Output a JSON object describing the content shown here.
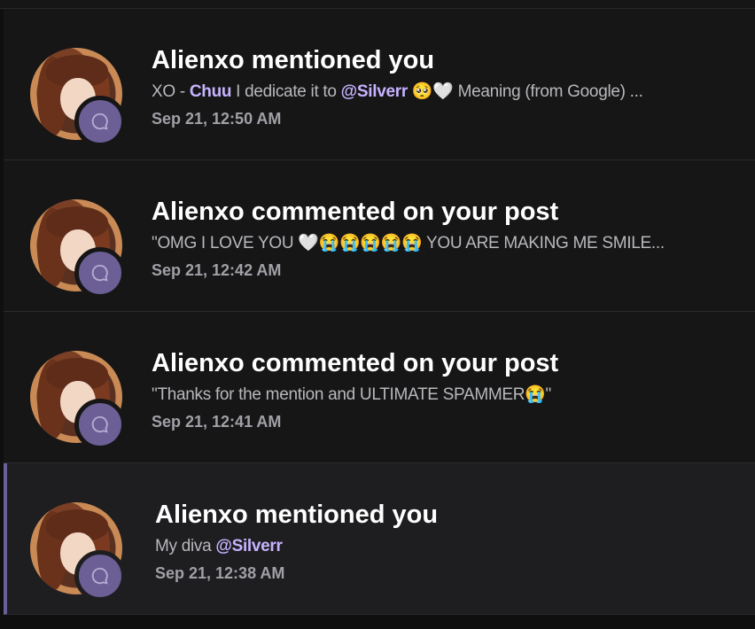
{
  "notifications": [
    {
      "title": "Alienxo mentioned you",
      "body_prefix": "XO - ",
      "body_mention1": "Chuu",
      "body_mid": " I dedicate it to ",
      "body_mention2": "@Silverr",
      "body_suffix": " 🥺🤍 Meaning (from Google) ...",
      "time": "Sep 21, 12:50 AM",
      "unread": false
    },
    {
      "title": "Alienxo commented on your post",
      "body": "\"OMG I LOVE YOU 🤍😭😭😭😭😭 YOU ARE MAKING ME SMILE...",
      "time": "Sep 21, 12:42 AM",
      "unread": false
    },
    {
      "title": "Alienxo commented on your post",
      "body": "\"Thanks for the mention and ULTIMATE SPAMMER😭\"",
      "time": "Sep 21, 12:41 AM",
      "unread": false
    },
    {
      "title": "Alienxo mentioned you",
      "body_prefix": "My diva ",
      "body_mention2": "@Silverr",
      "time": "Sep 21, 12:38 AM",
      "unread": true
    }
  ],
  "icons": {
    "badge": "chat-bubble-icon"
  },
  "colors": {
    "accent": "#c6b3ff",
    "badge": "#6b5f95",
    "unread_bar": "#6a5f98"
  }
}
